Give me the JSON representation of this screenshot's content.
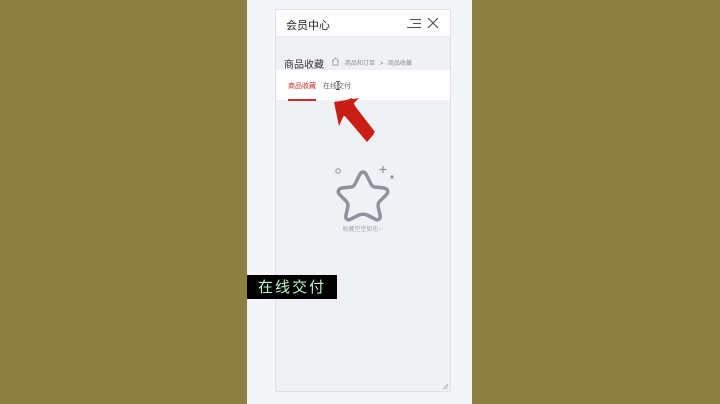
{
  "header": {
    "title": "会员中心",
    "menu_icon": "menu-icon",
    "close_icon": "close-icon"
  },
  "page": {
    "title": "商品收藏",
    "breadcrumb": [
      "商品和订单",
      ">",
      "商品收藏"
    ]
  },
  "tabs": [
    {
      "label": "商品收藏",
      "active": true
    },
    {
      "label": "在线交付",
      "active": false
    }
  ],
  "empty": {
    "icon": "star-icon",
    "text": "收藏空空如也~"
  },
  "overlay": {
    "caption": "在线交付",
    "arrow_color": "#c81e14"
  },
  "colors": {
    "accent": "#cf2d2d",
    "background": "#8c8143"
  }
}
